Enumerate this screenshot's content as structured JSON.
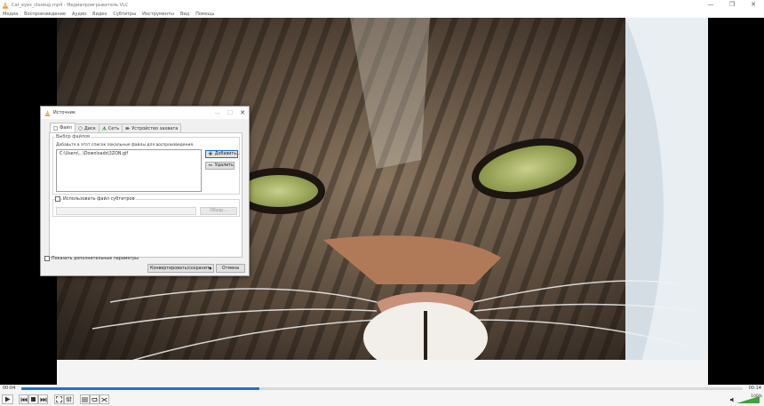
{
  "window": {
    "title": "Cat_eyes_closeup.mp4 - Медиапроигрыватель VLC",
    "controls": {
      "minimize": "—",
      "maximize": "❐",
      "close": "✕"
    }
  },
  "menu": [
    "Медиа",
    "Воспроизведение",
    "Аудио",
    "Видео",
    "Субтитры",
    "Инструменты",
    "Вид",
    "Помощь"
  ],
  "dialog": {
    "title": "Источник",
    "controls": {
      "minimize": "—",
      "maximize": "☐",
      "close": "✕"
    },
    "tabs": [
      {
        "label": "Файл",
        "icon": "file-icon"
      },
      {
        "label": "Диск",
        "icon": "disc-icon"
      },
      {
        "label": "Сеть",
        "icon": "network-icon"
      },
      {
        "label": "Устройство захвата",
        "icon": "capture-icon"
      }
    ],
    "file_group": {
      "legend": "Выбор файлов",
      "hint": "Добавьте в этот список локальные файлы для воспроизведения.",
      "files": [
        "C:\\Users\\...\\Downloads\\3ZON.gif"
      ],
      "add_label": "Добавить...",
      "remove_label": "Удалить"
    },
    "subtitle": {
      "checkbox_label": "Использовать файл субтитров",
      "checked": false,
      "path_value": "",
      "browse_label": "Обзор..."
    },
    "more_options_label": "Показать дополнительные параметры",
    "convert_label": "Конвертировать/сохранить",
    "cancel_label": "Отмена"
  },
  "player": {
    "elapsed": "00:04",
    "total": "00:14",
    "progress": 0.33,
    "volume_percent": "100%"
  },
  "icons": [
    "vlc-cone-icon",
    "play-icon",
    "prev-icon",
    "stop-icon",
    "next-icon",
    "fullscreen-icon",
    "extended-settings-icon",
    "playlist-icon",
    "loop-icon",
    "shuffle-icon",
    "volume-icon"
  ]
}
